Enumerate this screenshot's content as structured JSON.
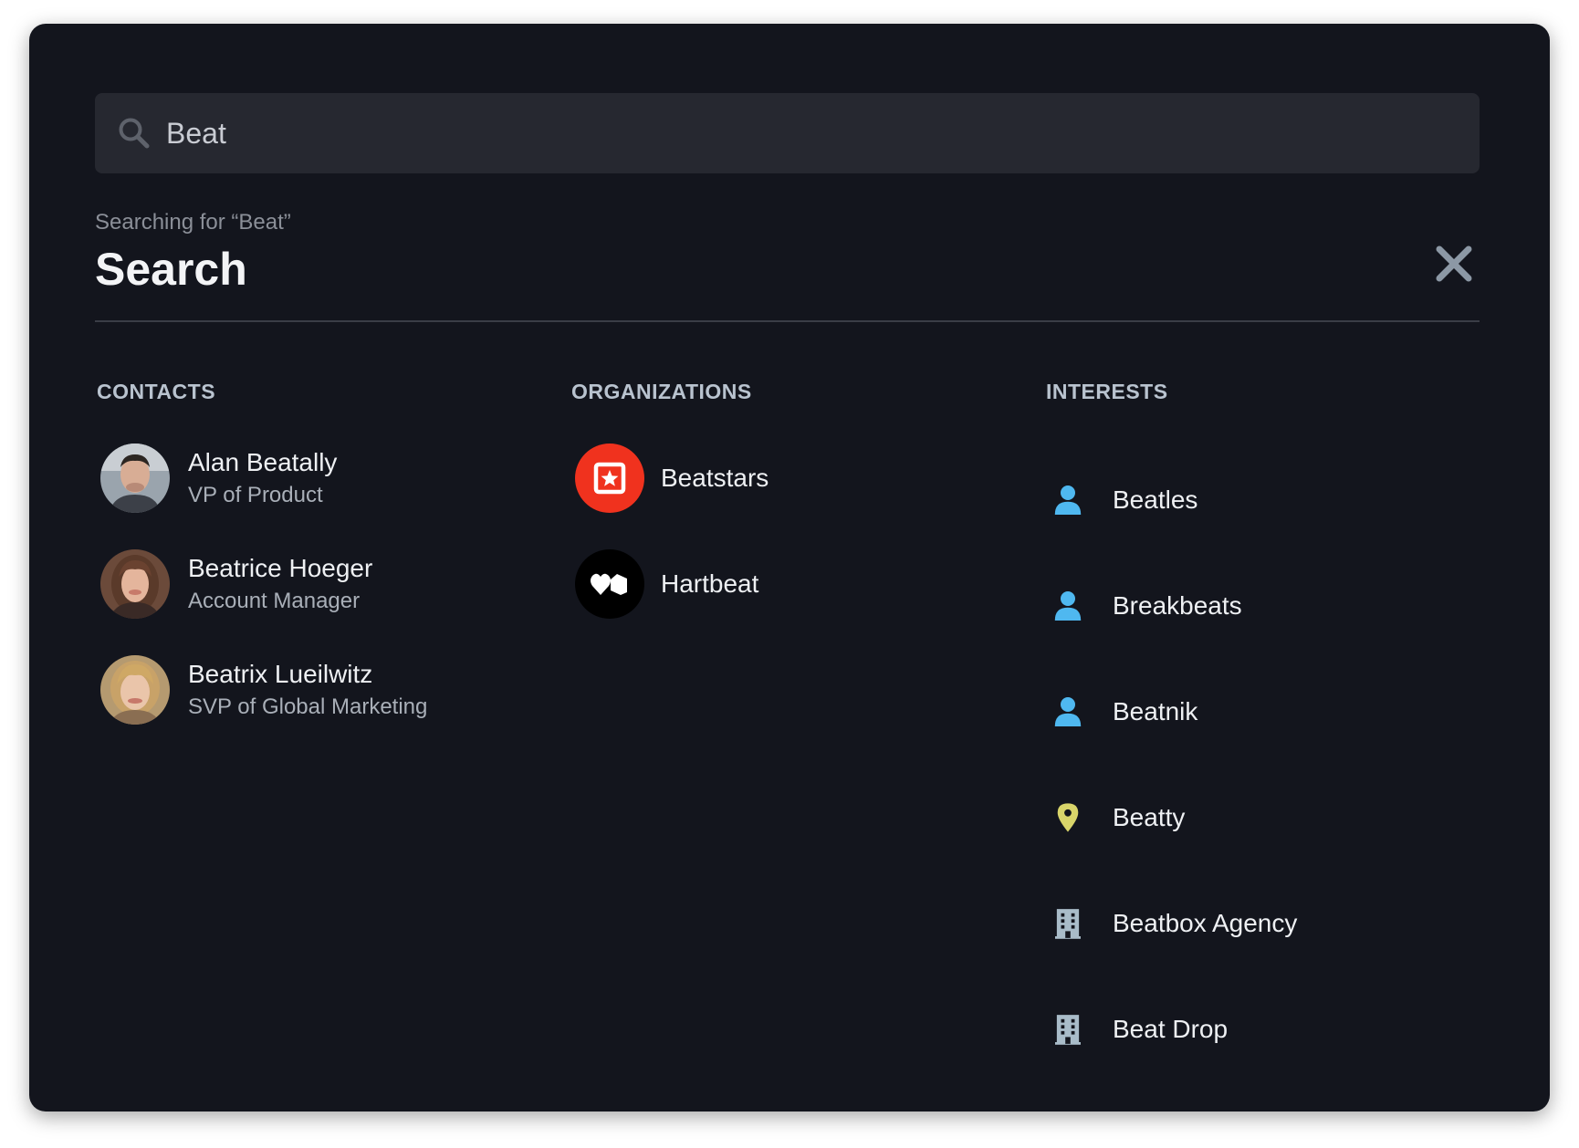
{
  "search": {
    "value": "Beat",
    "subtitle": "Searching for “Beat”",
    "title": "Search"
  },
  "columns": {
    "contacts": "CONTACTS",
    "organizations": "ORGANIZATIONS",
    "interests": "INTERESTS"
  },
  "contacts": [
    {
      "name": "Alan Beatally",
      "role": "VP of Product"
    },
    {
      "name": "Beatrice Hoeger",
      "role": "Account Manager"
    },
    {
      "name": "Beatrix Lueilwitz",
      "role": "SVP of Global Marketing"
    }
  ],
  "organizations": [
    {
      "name": "Beatstars",
      "logo": "beatstars-logo",
      "color": "#f0321e"
    },
    {
      "name": "Hartbeat",
      "logo": "hartbeat-logo",
      "color": "#000000"
    }
  ],
  "interests": [
    {
      "name": "Beatles",
      "icon": "person-icon",
      "color": "#4fb8f0"
    },
    {
      "name": "Breakbeats",
      "icon": "person-icon",
      "color": "#4fb8f0"
    },
    {
      "name": "Beatnik",
      "icon": "person-icon",
      "color": "#4fb8f0"
    },
    {
      "name": "Beatty",
      "icon": "location-pin-icon",
      "color": "#d9d56a"
    },
    {
      "name": "Beatbox Agency",
      "icon": "building-icon",
      "color": "#a9bcc9"
    },
    {
      "name": "Beat Drop",
      "icon": "building-icon",
      "color": "#a9bcc9"
    }
  ]
}
